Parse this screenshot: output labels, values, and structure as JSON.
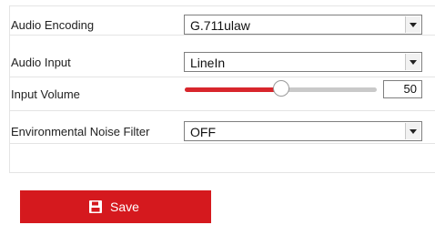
{
  "fields": [
    {
      "label": "Audio Encoding",
      "value": "G.711ulaw"
    },
    {
      "label": "Audio Input",
      "value": "LineIn"
    },
    {
      "label": "Input Volume",
      "value": "50"
    },
    {
      "label": "Environmental Noise Filter",
      "value": "OFF"
    }
  ],
  "volume": {
    "level": 0.5
  },
  "save_label": "Save",
  "colors": {
    "accent": "#d5191e",
    "border": "#e4e4e4"
  },
  "icons": {
    "save": "floppy-disk-icon",
    "dropdown": "chevron-down-icon"
  }
}
